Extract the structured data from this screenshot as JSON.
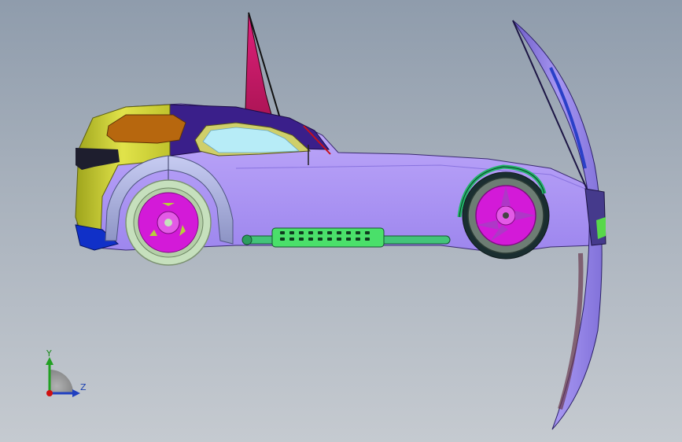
{
  "viewport": {
    "background_top": "#8f9cac",
    "background_bottom": "#c5cad0"
  },
  "model": {
    "colors": {
      "body_side": "#b39cf5",
      "roof": "#3a1f8a",
      "front_yellow": "#d7d83a",
      "window_orange": "#b7670e",
      "fin_magenta": "#c0125a",
      "fin_dark": "#6a0f2c",
      "wheel_magenta": "#d31ad8",
      "exhaust_green": "#4ae06a",
      "hood_panel": "#9a8ae6",
      "fender_grey": "#a7b0d6"
    }
  },
  "triad": {
    "y_label": "Y",
    "z_label": "Z",
    "y_color": "#1a8a1a",
    "z_color": "#1a3fb0",
    "origin_color": "#d01010"
  }
}
